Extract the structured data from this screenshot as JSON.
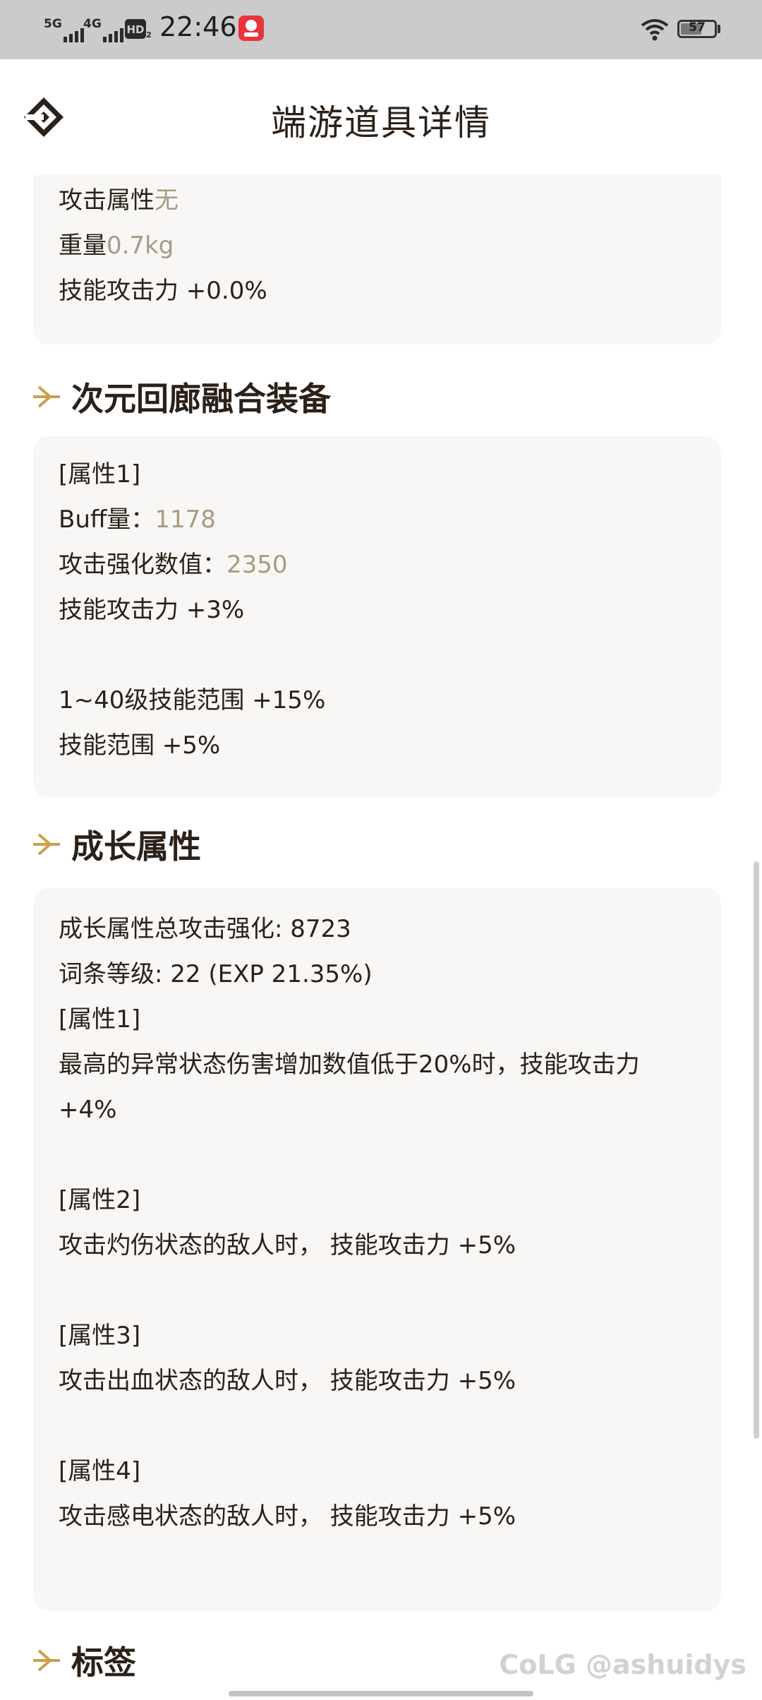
{
  "status_bar": {
    "network_1": "5G",
    "network_2": "4G",
    "hd_label": "HD",
    "time": "22:46",
    "battery": "57"
  },
  "header": {
    "title": "端游道具详情",
    "back_icon": "back-diamond-icon"
  },
  "card1": {
    "attack_attr_label": "攻击属性",
    "attack_attr_value": "无",
    "weight_label": "重量",
    "weight_value": "0.7kg",
    "skill_attack": "技能攻击力 +0.0%"
  },
  "section_fusion": {
    "title": "次元回廊融合装备",
    "attr_header": "[属性1]",
    "buff_label": "Buff量：",
    "buff_value": "1178",
    "enhance_label": "攻击强化数值：",
    "enhance_value": "2350",
    "skill_attack": "技能攻击力 +3%",
    "skill_range_1_40": "1~40级技能范围 +15%",
    "skill_range": "技能范围 +5%"
  },
  "section_growth": {
    "title": "成长属性",
    "total_enhance": "成长属性总攻击强化: 8723",
    "level": "词条等级: 22 (EXP 21.35%)",
    "attr1_header": "[属性1]",
    "attr1_text": "最高的异常状态伤害增加数值低于20%时，技能攻击力+4%",
    "attr2_header": "[属性2]",
    "attr2_text": "攻击灼伤状态的敌人时， 技能攻击力 +5%",
    "attr3_header": "[属性3]",
    "attr3_text": "攻击出血状态的敌人时， 技能攻击力 +5%",
    "attr4_header": "[属性4]",
    "attr4_text": "攻击感电状态的敌人时， 技能攻击力 +5%"
  },
  "section_tags": {
    "title": "标签"
  },
  "watermark": "CoLG @ashuidys",
  "colors": {
    "accent_gold": "#c9a14a",
    "value_gold": "#a89a82",
    "card_bg": "#f8f7f5",
    "text": "#2b2118"
  }
}
